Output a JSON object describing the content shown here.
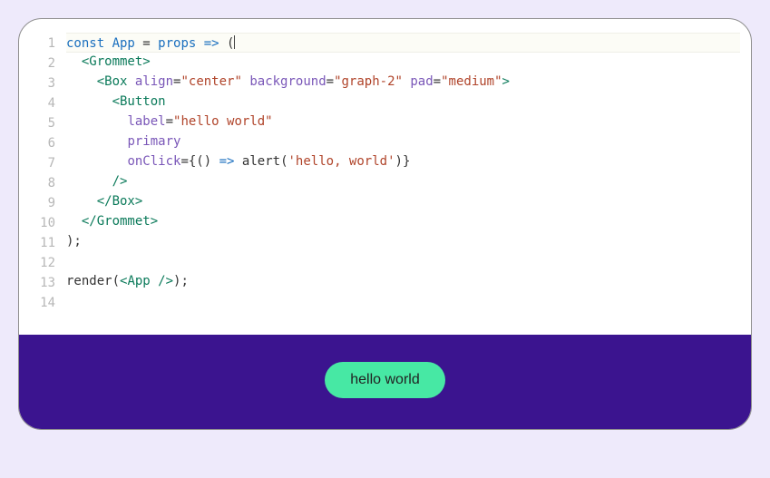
{
  "editor": {
    "line_numbers": [
      "1",
      "2",
      "3",
      "4",
      "5",
      "6",
      "7",
      "8",
      "9",
      "10",
      "11",
      "12",
      "13",
      "14"
    ],
    "lines": [
      {
        "indent": 0,
        "tokens": [
          {
            "t": "const ",
            "c": "kw"
          },
          {
            "t": "App ",
            "c": "def"
          },
          {
            "t": "= ",
            "c": "plain"
          },
          {
            "t": "props ",
            "c": "def"
          },
          {
            "t": "=> ",
            "c": "kw"
          },
          {
            "t": "(",
            "c": "plain"
          },
          {
            "t": "",
            "c": "caret"
          }
        ],
        "active": true
      },
      {
        "indent": 1,
        "tokens": [
          {
            "t": "<Grommet>",
            "c": "tag"
          }
        ]
      },
      {
        "indent": 2,
        "tokens": [
          {
            "t": "<Box ",
            "c": "tag"
          },
          {
            "t": "align",
            "c": "attr"
          },
          {
            "t": "=",
            "c": "plain"
          },
          {
            "t": "\"center\"",
            "c": "str"
          },
          {
            "t": " ",
            "c": "plain"
          },
          {
            "t": "background",
            "c": "attr"
          },
          {
            "t": "=",
            "c": "plain"
          },
          {
            "t": "\"graph-2\"",
            "c": "str"
          },
          {
            "t": " ",
            "c": "plain"
          },
          {
            "t": "pad",
            "c": "attr"
          },
          {
            "t": "=",
            "c": "plain"
          },
          {
            "t": "\"medium\"",
            "c": "str"
          },
          {
            "t": ">",
            "c": "tag"
          }
        ]
      },
      {
        "indent": 3,
        "tokens": [
          {
            "t": "<Button",
            "c": "tag"
          }
        ]
      },
      {
        "indent": 4,
        "tokens": [
          {
            "t": "label",
            "c": "attr"
          },
          {
            "t": "=",
            "c": "plain"
          },
          {
            "t": "\"hello world\"",
            "c": "str"
          }
        ]
      },
      {
        "indent": 4,
        "tokens": [
          {
            "t": "primary",
            "c": "attr"
          }
        ]
      },
      {
        "indent": 4,
        "tokens": [
          {
            "t": "onClick",
            "c": "attr"
          },
          {
            "t": "={() ",
            "c": "plain"
          },
          {
            "t": "=> ",
            "c": "kw"
          },
          {
            "t": "alert",
            "c": "plain"
          },
          {
            "t": "(",
            "c": "plain"
          },
          {
            "t": "'hello, world'",
            "c": "str"
          },
          {
            "t": ")}",
            "c": "plain"
          }
        ]
      },
      {
        "indent": 3,
        "tokens": [
          {
            "t": "/>",
            "c": "tag"
          }
        ]
      },
      {
        "indent": 2,
        "tokens": [
          {
            "t": "</Box>",
            "c": "tag"
          }
        ]
      },
      {
        "indent": 1,
        "tokens": [
          {
            "t": "</Grommet>",
            "c": "tag"
          }
        ]
      },
      {
        "indent": 0,
        "tokens": [
          {
            "t": ");",
            "c": "plain"
          }
        ]
      },
      {
        "indent": 0,
        "tokens": []
      },
      {
        "indent": 0,
        "tokens": [
          {
            "t": "render",
            "c": "plain"
          },
          {
            "t": "(",
            "c": "plain"
          },
          {
            "t": "<App ",
            "c": "tag"
          },
          {
            "t": "/>",
            "c": "tag"
          },
          {
            "t": ");",
            "c": "plain"
          }
        ]
      },
      {
        "indent": 0,
        "tokens": []
      }
    ]
  },
  "preview": {
    "button_label": "hello world"
  },
  "colors": {
    "page_bg": "#eeeafb",
    "panel_border": "#8f8f8f",
    "render_bg": "#3b148f",
    "button_bg": "#47e8a4"
  }
}
